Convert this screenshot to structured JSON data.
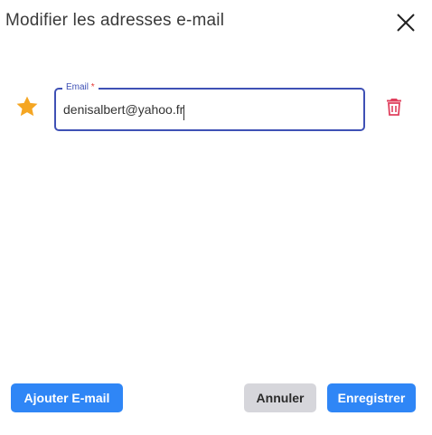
{
  "dialog": {
    "title": "Modifier les adresses e-mail"
  },
  "email_row": {
    "label": "Email",
    "required_mark": "*",
    "value": "denisalbert@yahoo.fr",
    "primary_icon": "star-icon",
    "delete_icon": "trash-icon"
  },
  "footer": {
    "add_label": "Ajouter E-mail",
    "cancel_label": "Annuler",
    "save_label": "Enregistrer"
  },
  "colors": {
    "primary": "#2f86f6",
    "focus_border": "#3f51b5",
    "star": "#f5a623",
    "delete": "#e0405e",
    "required": "#e53935",
    "secondary_button": "#d6d6db"
  }
}
